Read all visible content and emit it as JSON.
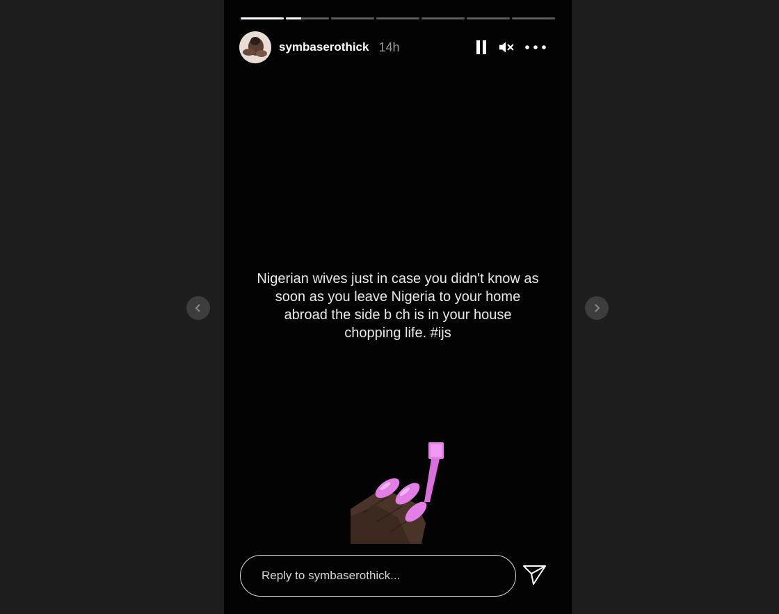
{
  "story": {
    "username": "symbaserothick",
    "time_ago": "14h",
    "progress": {
      "segments": 7,
      "completed": 1,
      "current_fraction": 0.35
    },
    "text_lines": [
      "Nigerian wives just in case you didn't know as",
      "soon as you leave Nigeria to your home",
      "abroad the side b  ch is in your house",
      "chopping life. #ijs"
    ],
    "emoji": "nail-polish-emoji"
  },
  "controls": {
    "pause_icon": "pause-icon",
    "mute_icon": "muted-speaker-icon",
    "more_icon": "more-options-icon"
  },
  "reply": {
    "placeholder": "Reply to symbaserothick...",
    "send_icon": "send-icon"
  },
  "navigation": {
    "prev_icon": "chevron-left-icon",
    "next_icon": "chevron-right-icon"
  },
  "colors": {
    "page_background": "#1d1d1d",
    "story_background": "#030303",
    "nail_pink": "#e27ee6",
    "skin": "#4a3429"
  }
}
